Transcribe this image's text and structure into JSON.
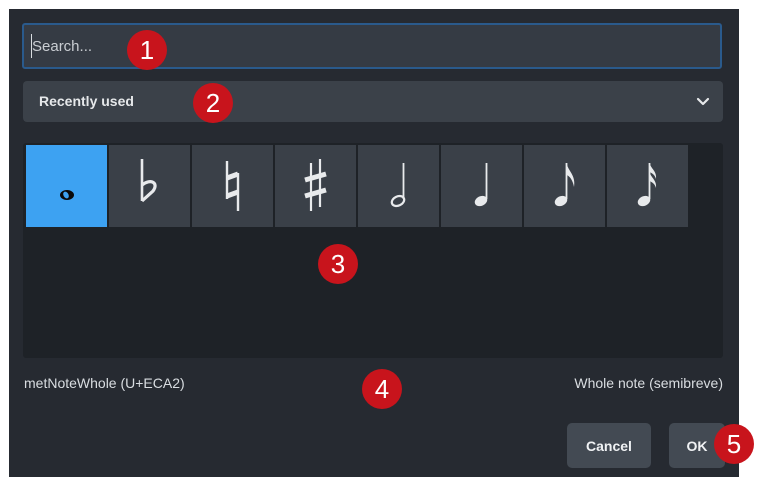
{
  "search": {
    "placeholder": "Search..."
  },
  "category": {
    "selected": "Recently used",
    "icon": "chevron-down-icon"
  },
  "glyphs": [
    {
      "name": "whole-note-icon",
      "selected": true
    },
    {
      "name": "flat-icon",
      "selected": false
    },
    {
      "name": "natural-icon",
      "selected": false
    },
    {
      "name": "sharp-icon",
      "selected": false
    },
    {
      "name": "half-note-icon",
      "selected": false
    },
    {
      "name": "quarter-note-icon",
      "selected": false
    },
    {
      "name": "eighth-note-icon",
      "selected": false
    },
    {
      "name": "sixteenth-note-icon",
      "selected": false
    }
  ],
  "info": {
    "glyph_id": "metNoteWhole (U+ECA2)",
    "description": "Whole note (semibreve)"
  },
  "buttons": {
    "cancel": "Cancel",
    "ok": "OK"
  },
  "callouts": [
    "1",
    "2",
    "3",
    "4",
    "5"
  ],
  "colors": {
    "accent": "#3da2f2",
    "callout": "#c8141c",
    "background": "#262a31"
  }
}
